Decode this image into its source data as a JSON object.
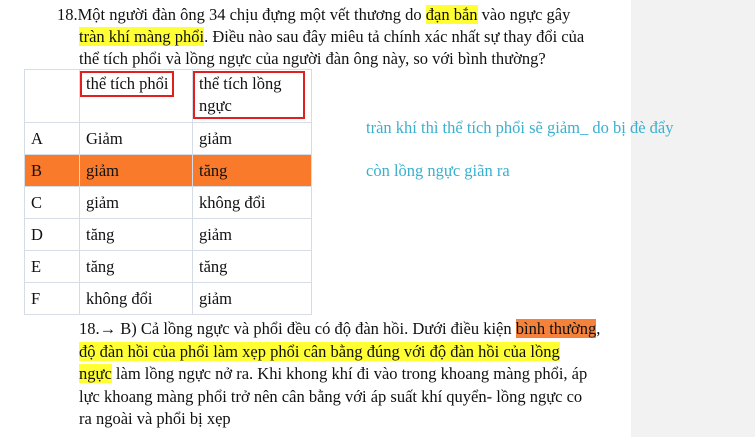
{
  "question": {
    "line1_pre": "18.Một người đàn ông 34 chịu đựng một vết thương do ",
    "line1_hl": "đạn bắn",
    "line1_post": " vào ngực gây",
    "line2_hl": "tràn khí màng phổi",
    "line2_post": ". Điều nào sau đây miêu tả chính xác nhất sự thay đổi của",
    "line3": "thể tích phổi và lồng ngực của người đàn ông này, so với bình thường?"
  },
  "table": {
    "headers": [
      "thể tích phổi",
      "thể tích lồng ngực"
    ],
    "rows": [
      {
        "letter": "A",
        "lung": "Giảm",
        "chest": "giảm"
      },
      {
        "letter": "B",
        "lung": "giảm",
        "chest": "tăng"
      },
      {
        "letter": "C",
        "lung": "giảm",
        "chest": "không đổi"
      },
      {
        "letter": "D",
        "lung": "tăng",
        "chest": "giảm"
      },
      {
        "letter": "E",
        "lung": "tăng",
        "chest": "tăng"
      },
      {
        "letter": "F",
        "lung": "không đổi",
        "chest": "giảm"
      }
    ]
  },
  "notes": {
    "line1": "tràn khí thì thể tích phổi sẽ giảm_ do bị đè đẩy",
    "line2": "còn lồng ngực giãn ra"
  },
  "answer": {
    "line1_pre": "18.→ B) Cả lồng ngực và phổi đều có độ đàn hồi. Dưới điều kiện ",
    "line1_hl": "bình thường",
    "line1_post": ",",
    "line2_hl": "độ đàn hồi của phổi làm xẹp phổi cân bằng đúng với độ đàn hồi của lồng",
    "line3_hl": "ngực",
    "line3_post": " làm lồng ngực nở ra. Khi khong khí đi vào trong khoang màng phổi, áp",
    "line4": "lực khoang màng phổi trở nên cân bằng với áp suất khí quyển- lồng ngực co",
    "line5": "ra ngoài và phổi bị xẹp"
  },
  "colors": {
    "yellow_highlight": "#ffff33",
    "orange_highlight": "#f4823a",
    "selected_row": "#f97a2a",
    "box_border": "#e01f1f",
    "note_text": "#39b0cf"
  }
}
